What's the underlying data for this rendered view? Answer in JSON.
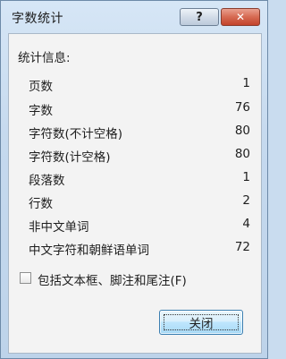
{
  "window": {
    "title": "字数统计",
    "help_label": "?",
    "close_x_label": "✕"
  },
  "stats": {
    "heading": "统计信息:",
    "rows": [
      {
        "label": "页数",
        "value": "1"
      },
      {
        "label": "字数",
        "value": "76"
      },
      {
        "label": "字符数(不计空格)",
        "value": "80"
      },
      {
        "label": "字符数(计空格)",
        "value": "80"
      },
      {
        "label": "段落数",
        "value": "1"
      },
      {
        "label": "行数",
        "value": "2"
      },
      {
        "label": "非中文单词",
        "value": "4"
      },
      {
        "label": "中文字符和朝鲜语单词",
        "value": "72"
      }
    ]
  },
  "options": {
    "include_textboxes_label": "包括文本框、脚注和尾注(F)",
    "include_textboxes_checked": false
  },
  "buttons": {
    "close_label": "关闭"
  }
}
